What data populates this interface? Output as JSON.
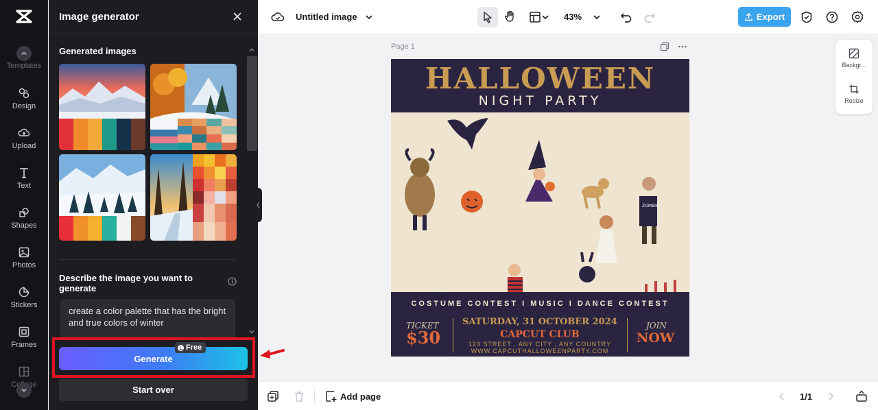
{
  "rail": {
    "items": [
      {
        "label": "Templates"
      },
      {
        "label": "Design"
      },
      {
        "label": "Upload"
      },
      {
        "label": "Text"
      },
      {
        "label": "Shapes"
      },
      {
        "label": "Photos"
      },
      {
        "label": "Stickers"
      },
      {
        "label": "Frames"
      },
      {
        "label": "Collage"
      }
    ]
  },
  "panel": {
    "title": "Image generator",
    "generated_title": "Generated images",
    "prompt_label": "Describe the image you want to generate",
    "prompt_value": "create a color palette that has the bright and true colors of winter",
    "generate_label": "Generate",
    "free_label": "Free",
    "start_over_label": "Start over"
  },
  "topbar": {
    "doc_title": "Untitled image",
    "zoom": "43%",
    "export_label": "Export"
  },
  "canvas": {
    "page_label": "Page 1",
    "poster": {
      "title": "HALLOWEEN",
      "subtitle": "NIGHT PARTY",
      "contest_line": "COSTUME CONTEST  I  MUSIC  I  DANCE CONTEST",
      "ticket_word": "TICKET",
      "ticket_price": "$30",
      "date": "SATURDAY, 31 OCTOBER  2024",
      "club": "CAPCUT CLUB",
      "address": "123 STREET , ANY CITY , ANY COUNTRY",
      "website": "WWW.CAPCUTHALLOWEENPARTY.COM",
      "join_word": "JOIN",
      "join_now": "NOW"
    }
  },
  "float_panel": {
    "background_label": "Backgr...",
    "resize_label": "Resize"
  },
  "bottombar": {
    "add_page_label": "Add page",
    "page_count": "1/1"
  },
  "colors": {
    "accent_export": "#3aa4ee",
    "highlight": "#e0141e",
    "panel_bg": "#1c1c21",
    "poster_bg": "#2a2440",
    "poster_gold": "#c99c54"
  }
}
